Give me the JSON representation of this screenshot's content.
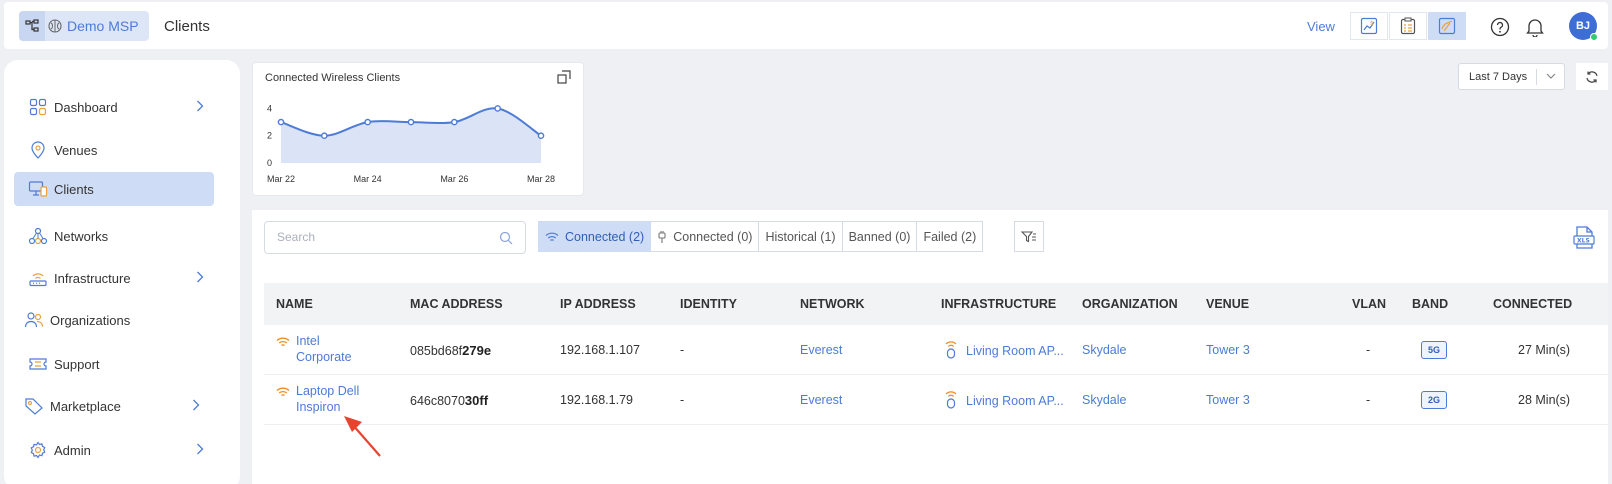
{
  "header": {
    "org_name": "Demo MSP",
    "page_title": "Clients",
    "view_label": "View",
    "avatar_initials": "BJ"
  },
  "sidebar": {
    "items": [
      {
        "label": "Dashboard",
        "icon": "dashboard-icon",
        "chevron": true
      },
      {
        "label": "Venues",
        "icon": "location-pin-icon",
        "chevron": false
      },
      {
        "label": "Clients",
        "icon": "devices-icon",
        "chevron": false,
        "active": true
      },
      {
        "label": "Networks",
        "icon": "network-icon",
        "chevron": false
      },
      {
        "label": "Infrastructure",
        "icon": "router-icon",
        "chevron": true
      },
      {
        "label": "Organizations",
        "icon": "users-icon",
        "chevron": false
      },
      {
        "label": "Support",
        "icon": "ticket-icon",
        "chevron": false
      },
      {
        "label": "Marketplace",
        "icon": "tag-icon",
        "chevron": true
      },
      {
        "label": "Admin",
        "icon": "gear-icon",
        "chevron": true
      }
    ]
  },
  "chart": {
    "title": "Connected Wireless Clients"
  },
  "chart_data": {
    "type": "area",
    "title": "Connected Wireless Clients",
    "x": [
      "Mar 22",
      "Mar 23",
      "Mar 24",
      "Mar 25",
      "Mar 26",
      "Mar 27",
      "Mar 28"
    ],
    "xticks": [
      "Mar 22",
      "Mar 24",
      "Mar 26",
      "Mar 28"
    ],
    "values": [
      3,
      2,
      3,
      3,
      3,
      4,
      2
    ],
    "yticks": [
      0,
      2,
      4
    ],
    "ylim": [
      0,
      4.4
    ],
    "grid": false,
    "color": "#4d7bd6",
    "fill_color": "#dbe4f6"
  },
  "range_select": {
    "value": "Last 7 Days"
  },
  "search": {
    "placeholder": "Search"
  },
  "tabs": [
    {
      "label": "Connected (2)",
      "icon": "wifi-icon",
      "active": true
    },
    {
      "label": "Connected (0)",
      "icon": "wired-plug-icon",
      "active": false
    },
    {
      "label": "Historical (1)",
      "icon": "",
      "active": false
    },
    {
      "label": "Banned (0)",
      "icon": "",
      "active": false
    },
    {
      "label": "Failed (2)",
      "icon": "",
      "active": false
    }
  ],
  "table": {
    "columns": [
      "NAME",
      "MAC ADDRESS",
      "IP ADDRESS",
      "IDENTITY",
      "NETWORK",
      "INFRASTRUCTURE",
      "ORGANIZATION",
      "VENUE",
      "VLAN",
      "BAND",
      "CONNECTED"
    ],
    "rows": [
      {
        "name_line1": "Intel",
        "name_line2": "Corporate",
        "mac_prefix": "085bd68f",
        "mac_suffix": "279e",
        "ip": "192.168.1.107",
        "identity": "-",
        "network": "Everest",
        "infrastructure": "Living Room AP...",
        "organization": "Skydale",
        "venue": "Tower 3",
        "vlan": "-",
        "band": "5G",
        "connected": "27 Min(s)"
      },
      {
        "name_line1": "Laptop Dell",
        "name_line2": "Inspiron",
        "mac_prefix": "646c8070",
        "mac_suffix": "30ff",
        "ip": "192.168.1.79",
        "identity": "-",
        "network": "Everest",
        "infrastructure": "Living Room AP...",
        "organization": "Skydale",
        "venue": "Tower 3",
        "vlan": "-",
        "band": "2G",
        "connected": "28 Min(s)"
      }
    ]
  },
  "colors": {
    "accent": "#4d7bd6",
    "active_bg": "#cfdcf5",
    "wifi_orange": "#f08a24",
    "annotation_arrow": "#e8432f"
  }
}
